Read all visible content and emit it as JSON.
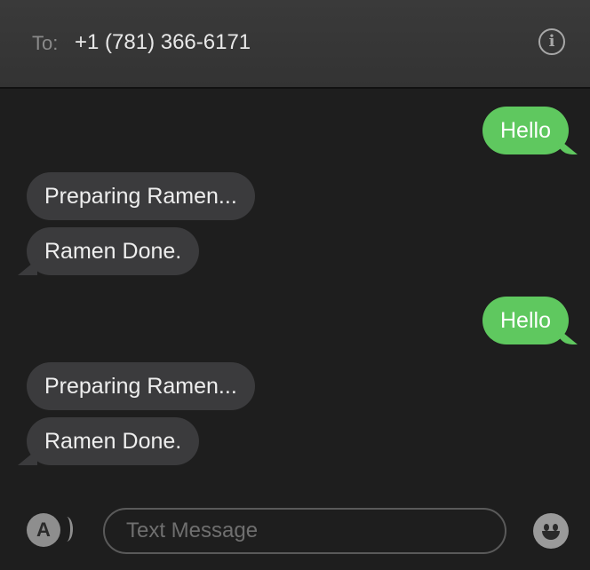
{
  "header": {
    "to_label": "To:",
    "recipient": "+1 (781) 366-6171",
    "info_icon": "info-icon"
  },
  "messages": [
    {
      "direction": "sent",
      "text": "Hello"
    },
    {
      "direction": "received",
      "text": "Preparing Ramen..."
    },
    {
      "direction": "received",
      "text": "Ramen Done."
    },
    {
      "direction": "sent",
      "text": "Hello"
    },
    {
      "direction": "received",
      "text": "Preparing Ramen..."
    },
    {
      "direction": "received",
      "text": "Ramen Done."
    }
  ],
  "composer": {
    "placeholder": "Text Message",
    "value": "",
    "apps_icon": "app-store-icon",
    "emoji_icon": "emoji-icon"
  },
  "colors": {
    "sent_bubble": "#5fc85f",
    "received_bubble": "#3b3b3d",
    "background": "#1e1e1e"
  }
}
